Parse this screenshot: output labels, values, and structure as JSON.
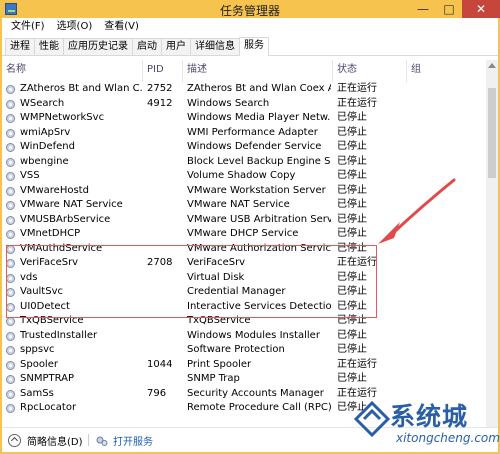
{
  "window": {
    "title": "任务管理器"
  },
  "menu": [
    "文件(F)",
    "选项(O)",
    "查看(V)"
  ],
  "tabs": [
    "进程",
    "性能",
    "应用历史记录",
    "启动",
    "用户",
    "详细信息",
    "服务"
  ],
  "active_tab": "服务",
  "columns": {
    "name": "名称",
    "pid": "PID",
    "description": "描述",
    "status": "状态",
    "group": "组"
  },
  "services": [
    {
      "name": "ZAtheros Bt and Wlan C...",
      "pid": "2752",
      "description": "ZAtheros Bt and Wlan Coex A...",
      "status": "正在运行"
    },
    {
      "name": "WSearch",
      "pid": "4912",
      "description": "Windows Search",
      "status": "正在运行"
    },
    {
      "name": "WMPNetworkSvc",
      "pid": "",
      "description": "Windows Media Player Netw...",
      "status": "已停止"
    },
    {
      "name": "wmiApSrv",
      "pid": "",
      "description": "WMI Performance Adapter",
      "status": "已停止"
    },
    {
      "name": "WinDefend",
      "pid": "",
      "description": "Windows Defender Service",
      "status": "已停止"
    },
    {
      "name": "wbengine",
      "pid": "",
      "description": "Block Level Backup Engine Se...",
      "status": "已停止"
    },
    {
      "name": "VSS",
      "pid": "",
      "description": "Volume Shadow Copy",
      "status": "已停止"
    },
    {
      "name": "VMwareHostd",
      "pid": "",
      "description": "VMware Workstation Server",
      "status": "已停止"
    },
    {
      "name": "VMware NAT Service",
      "pid": "",
      "description": "VMware NAT Service",
      "status": "已停止"
    },
    {
      "name": "VMUSBArbService",
      "pid": "",
      "description": "VMware USB Arbitration Serv...",
      "status": "已停止"
    },
    {
      "name": "VMnetDHCP",
      "pid": "",
      "description": "VMware DHCP Service",
      "status": "已停止"
    },
    {
      "name": "VMAuthdService",
      "pid": "",
      "description": "VMware Authorization Service",
      "status": "已停止"
    },
    {
      "name": "VeriFaceSrv",
      "pid": "2708",
      "description": "VeriFaceSrv",
      "status": "正在运行"
    },
    {
      "name": "vds",
      "pid": "",
      "description": "Virtual Disk",
      "status": "已停止"
    },
    {
      "name": "VaultSvc",
      "pid": "",
      "description": "Credential Manager",
      "status": "已停止"
    },
    {
      "name": "UI0Detect",
      "pid": "",
      "description": "Interactive Services Detection",
      "status": "已停止"
    },
    {
      "name": "TxQBService",
      "pid": "",
      "description": "TxQBService",
      "status": "已停止"
    },
    {
      "name": "TrustedInstaller",
      "pid": "",
      "description": "Windows Modules Installer",
      "status": "已停止"
    },
    {
      "name": "sppsvc",
      "pid": "",
      "description": "Software Protection",
      "status": "已停止"
    },
    {
      "name": "Spooler",
      "pid": "1044",
      "description": "Print Spooler",
      "status": "正在运行"
    },
    {
      "name": "SNMPTRAP",
      "pid": "",
      "description": "SNMP Trap",
      "status": "已停止"
    },
    {
      "name": "SamSs",
      "pid": "796",
      "description": "Security Accounts Manager",
      "status": "正在运行"
    },
    {
      "name": "RpcLocator",
      "pid": "",
      "description": "Remote Procedure Call (RPC)...",
      "status": "已停止"
    }
  ],
  "footer": {
    "fewer_details": "简略信息(D)",
    "open_services": "打开服务"
  },
  "watermark": {
    "text": "系统城",
    "sub": "xitongcheng.com"
  },
  "colors": {
    "titlebar": "#f5c34e",
    "close": "#c7463c",
    "highlight": "#e25a5a",
    "link": "#1f5fb3"
  }
}
